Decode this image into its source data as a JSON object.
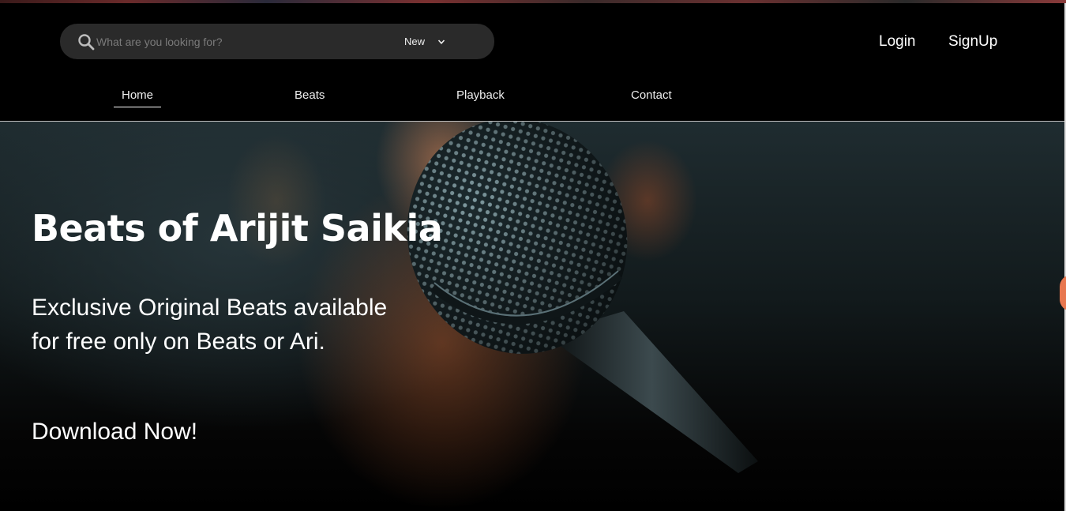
{
  "header": {
    "search": {
      "placeholder": "What are you looking for?",
      "value": "",
      "icon": "search-icon"
    },
    "sort": {
      "selected": "New",
      "icon": "chevron-down-icon"
    },
    "login_label": "Login",
    "signup_label": "SignUp"
  },
  "nav": {
    "items": [
      {
        "label": "Home",
        "active": true
      },
      {
        "label": "Beats",
        "active": false
      },
      {
        "label": "Playback",
        "active": false
      },
      {
        "label": "Contact",
        "active": false
      }
    ]
  },
  "hero": {
    "title": "Beats of Arijit Saikia",
    "subtitle": "Exclusive Original Beats available for free only on Beats or Ari.",
    "cta": "Download Now!"
  },
  "colors": {
    "background": "#000000",
    "search_bg": "#2a2a2a",
    "text": "#ffffff",
    "chat_bubble": "#e8774f"
  }
}
